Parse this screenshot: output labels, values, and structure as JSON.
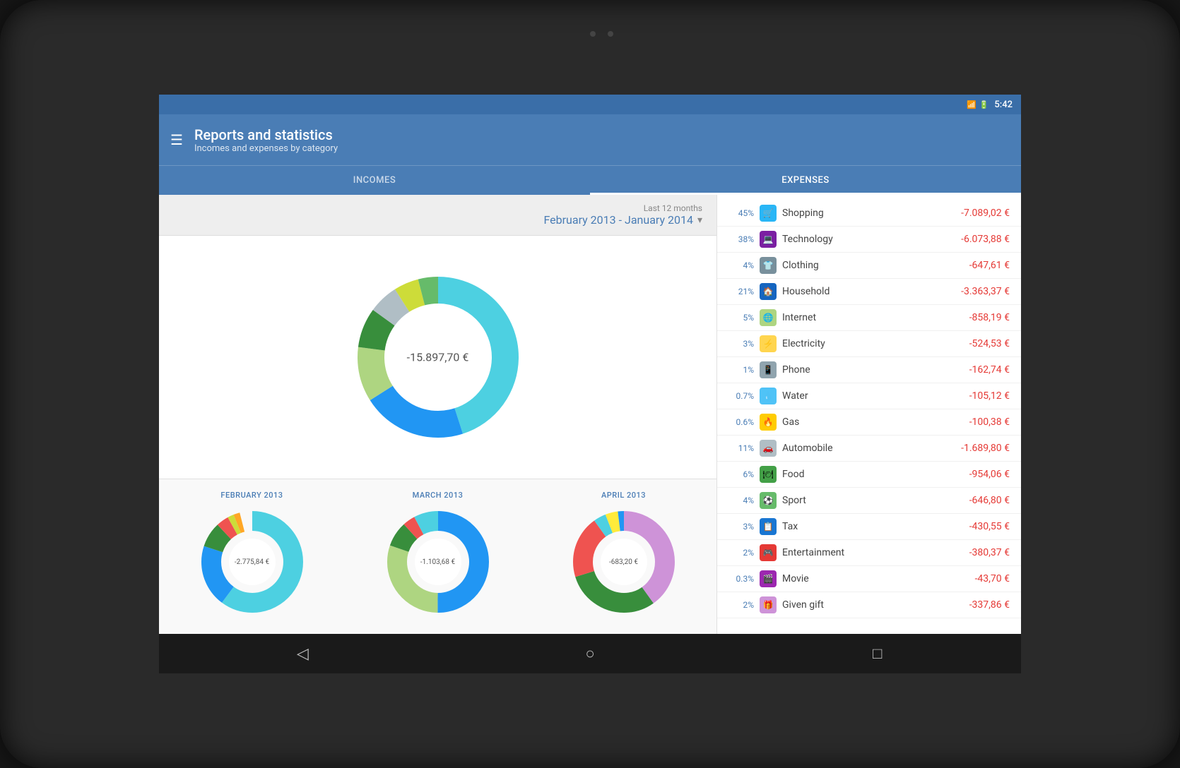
{
  "device": {
    "time": "5:42",
    "camera_top_center": true
  },
  "app_bar": {
    "title": "Reports and statistics",
    "subtitle": "Incomes and expenses by category",
    "menu_icon": "☰"
  },
  "tabs": [
    {
      "id": "incomes",
      "label": "INCOMES",
      "active": false
    },
    {
      "id": "expenses",
      "label": "EXPENSES",
      "active": true
    }
  ],
  "date_range": {
    "label": "Last 12 months",
    "value": "February 2013 - January 2014"
  },
  "main_donut": {
    "total": "-15.897,70 €",
    "segments": [
      {
        "name": "Shopping",
        "percent": 45,
        "color": "#4dd0e1",
        "startAngle": 0
      },
      {
        "name": "Household",
        "percent": 21,
        "color": "#2196f3",
        "startAngle": 162
      },
      {
        "name": "Automobile",
        "percent": 11,
        "color": "#aed581",
        "startAngle": 237.6
      },
      {
        "name": "Technology",
        "percent": 8,
        "color": "#388e3c",
        "startAngle": 277.2
      },
      {
        "name": "Food",
        "percent": 6,
        "color": "#b0bec5",
        "startAngle": 306
      },
      {
        "name": "Internet",
        "percent": 5,
        "color": "#cddc39",
        "startAngle": 327.6
      },
      {
        "name": "Sport",
        "percent": 4,
        "color": "#66bb6a",
        "startAngle": 345.6
      },
      {
        "name": "Clothing",
        "percent": 4,
        "color": "#ef5350",
        "startAngle": 360.6
      },
      {
        "name": "Tax",
        "percent": 3,
        "color": "#ffa726",
        "startAngle": 375
      },
      {
        "name": "Electricity",
        "percent": 3,
        "color": "#ffeb3b",
        "startAngle": 385.2
      },
      {
        "name": "Entertainment",
        "percent": 2,
        "color": "#ab47bc",
        "startAngle": 396
      },
      {
        "name": "Given gift",
        "percent": 2,
        "color": "#ec407a",
        "startAngle": 403.2
      },
      {
        "name": "Phone",
        "percent": 1,
        "color": "#78909c",
        "startAngle": 410.4
      }
    ]
  },
  "monthly_donuts": [
    {
      "month": "FEBRUARY 2013",
      "total": "-2.775,84 €",
      "colors": [
        "#4dd0e1",
        "#2196f3",
        "#388e3c",
        "#ef5350",
        "#cddc39",
        "#ffa726"
      ]
    },
    {
      "month": "MARCH 2013",
      "total": "-1.103,68 €",
      "colors": [
        "#2196f3",
        "#aed581",
        "#388e3c",
        "#ef5350",
        "#4dd0e1"
      ]
    },
    {
      "month": "APRIL 2013",
      "total": "-683,20 €",
      "colors": [
        "#ce93d8",
        "#388e3c",
        "#ef5350",
        "#4dd0e1",
        "#ffeb3b",
        "#2196f3"
      ]
    }
  ],
  "categories": [
    {
      "percent": "45%",
      "name": "Shopping",
      "amount": "-7.089,02 €",
      "icon_color": "#29b6f6",
      "icon_char": "🛒"
    },
    {
      "percent": "38%",
      "name": "Technology",
      "amount": "-6.073,88 €",
      "icon_color": "#7b1fa2",
      "icon_char": "💻"
    },
    {
      "percent": "4%",
      "name": "Clothing",
      "amount": "-647,61 €",
      "icon_color": "#78909c",
      "icon_char": "👕"
    },
    {
      "percent": "21%",
      "name": "Household",
      "amount": "-3.363,37 €",
      "icon_color": "#1565c0",
      "icon_char": "🏠"
    },
    {
      "percent": "5%",
      "name": "Internet",
      "amount": "-858,19 €",
      "icon_color": "#aed581",
      "icon_char": "🌐"
    },
    {
      "percent": "3%",
      "name": "Electricity",
      "amount": "-524,53 €",
      "icon_color": "#ffd54f",
      "icon_char": "⚡"
    },
    {
      "percent": "1%",
      "name": "Phone",
      "amount": "-162,74 €",
      "icon_color": "#90a4ae",
      "icon_char": "📱"
    },
    {
      "percent": "0.7%",
      "name": "Water",
      "amount": "-105,12 €",
      "icon_color": "#4fc3f7",
      "icon_char": "💧"
    },
    {
      "percent": "0.6%",
      "name": "Gas",
      "amount": "-100,38 €",
      "icon_color": "#ffcc02",
      "icon_char": "🔥"
    },
    {
      "percent": "11%",
      "name": "Automobile",
      "amount": "-1.689,80 €",
      "icon_color": "#b0bec5",
      "icon_char": "🚗"
    },
    {
      "percent": "6%",
      "name": "Food",
      "amount": "-954,06 €",
      "icon_color": "#43a047",
      "icon_char": "🍽"
    },
    {
      "percent": "4%",
      "name": "Sport",
      "amount": "-646,80 €",
      "icon_color": "#66bb6a",
      "icon_char": "⚽"
    },
    {
      "percent": "3%",
      "name": "Tax",
      "amount": "-430,55 €",
      "icon_color": "#1976d2",
      "icon_char": "📋"
    },
    {
      "percent": "2%",
      "name": "Entertainment",
      "amount": "-380,37 €",
      "icon_color": "#e53935",
      "icon_char": "🎮"
    },
    {
      "percent": "0.3%",
      "name": "Movie",
      "amount": "-43,70 €",
      "icon_color": "#9c27b0",
      "icon_char": "🎬"
    },
    {
      "percent": "2%",
      "name": "Given gift",
      "amount": "-337,86 €",
      "icon_color": "#ce93d8",
      "icon_char": "🎁"
    }
  ],
  "bottom_nav": {
    "back": "◁",
    "home": "○",
    "recent": "□"
  }
}
